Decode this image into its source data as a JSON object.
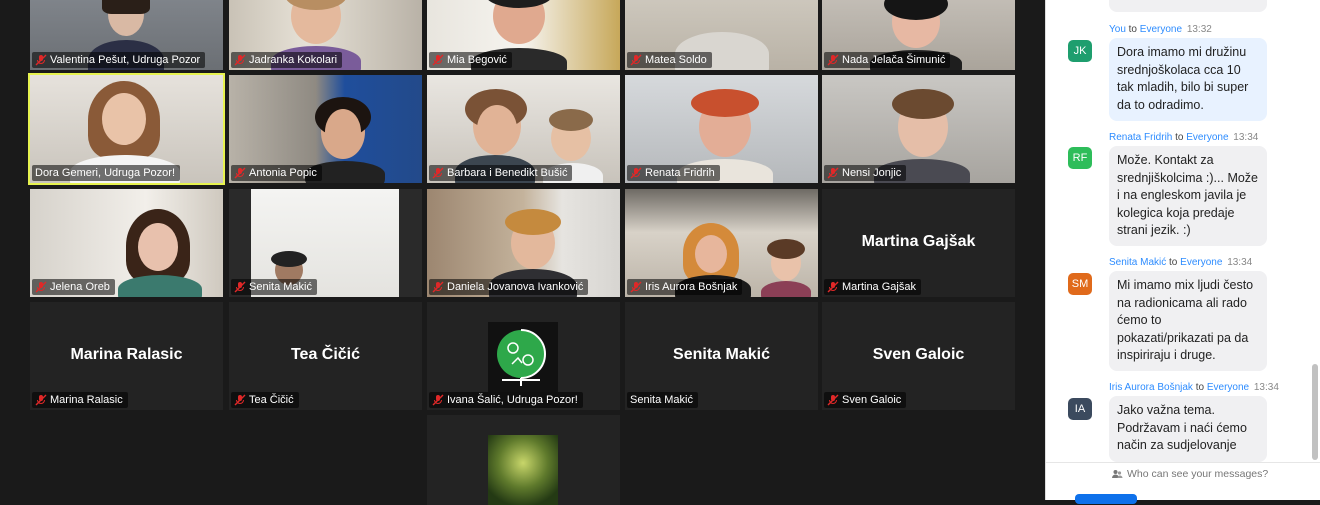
{
  "participants": [
    {
      "name": "Valentina Pešut, Udruga Pozor",
      "muted": true
    },
    {
      "name": "Jadranka Kokolari",
      "muted": true
    },
    {
      "name": "Mia Begović",
      "muted": true
    },
    {
      "name": "Matea Soldo",
      "muted": true
    },
    {
      "name": "Nada Jelača Šimunić",
      "muted": true
    },
    {
      "name": "Dora Gemeri, Udruga Pozor!",
      "muted": false
    },
    {
      "name": "Antonia Popic",
      "muted": true
    },
    {
      "name": "Barbara i Benedikt Bušić",
      "muted": true
    },
    {
      "name": "Renata Fridrih",
      "muted": true
    },
    {
      "name": "Nensi Jonjic",
      "muted": true
    },
    {
      "name": "Jelena Oreb",
      "muted": true
    },
    {
      "name": "Senita Makić",
      "muted": true
    },
    {
      "name": "Daniela Jovanova Ivanković",
      "muted": true
    },
    {
      "name": "Iris Aurora Bošnjak",
      "muted": true
    },
    {
      "name": "Martina Gajšak",
      "muted": true,
      "display_name": "Martina Gajšak"
    },
    {
      "name": "Marina Ralasic",
      "muted": true,
      "display_name": "Marina Ralasic"
    },
    {
      "name": "Tea Čičić",
      "muted": true,
      "display_name": "Tea Čičić"
    },
    {
      "name": "Ivana Šalić, Udruga Pozor!",
      "muted": true
    },
    {
      "name": "Senita Makić",
      "muted": false,
      "display_name": "Senita Makić"
    },
    {
      "name": "Sven Galoic",
      "muted": true,
      "display_name": "Sven Galoic"
    }
  ],
  "chat": {
    "messages": [
      {
        "sender": "You",
        "to_word": "to",
        "recipient": "Everyone",
        "time": "13:32",
        "initials": "JK",
        "avatar_color": "#1e9e6e",
        "text": "Dora imamo mi družinu srednjoškolaca cca 10 tak mladih, bilo bi super da to odradimo."
      },
      {
        "sender": "Renata Fridrih",
        "to_word": "to",
        "recipient": "Everyone",
        "time": "13:34",
        "initials": "RF",
        "avatar_color": "#2ebd5a",
        "text": "Može. Kontakt za srednjiškolcima :)... Može i na engleskom javila je kolegica koja predaje strani jezik. :)"
      },
      {
        "sender": "Senita Makić",
        "to_word": "to",
        "recipient": "Everyone",
        "time": "13:34",
        "initials": "SM",
        "avatar_color": "#e06a1b",
        "text": "Mi imamo mix ljudi često na radionicama ali rado ćemo to pokazati/prikazati pa da inspiriraju i druge."
      },
      {
        "sender": "Iris Aurora Bošnjak",
        "to_word": "to",
        "recipient": "Everyone",
        "time": "13:34",
        "initials": "IA",
        "avatar_color": "#3b4a5e",
        "text": "Jako važna tema. Podržavam i naći ćemo način za sudjelovanje"
      }
    ],
    "visibility_note": "Who can see your messages?"
  },
  "colors": {
    "active_speaker": "#e7f34f",
    "mute_icon": "#e02828",
    "link": "#2d8cff"
  }
}
